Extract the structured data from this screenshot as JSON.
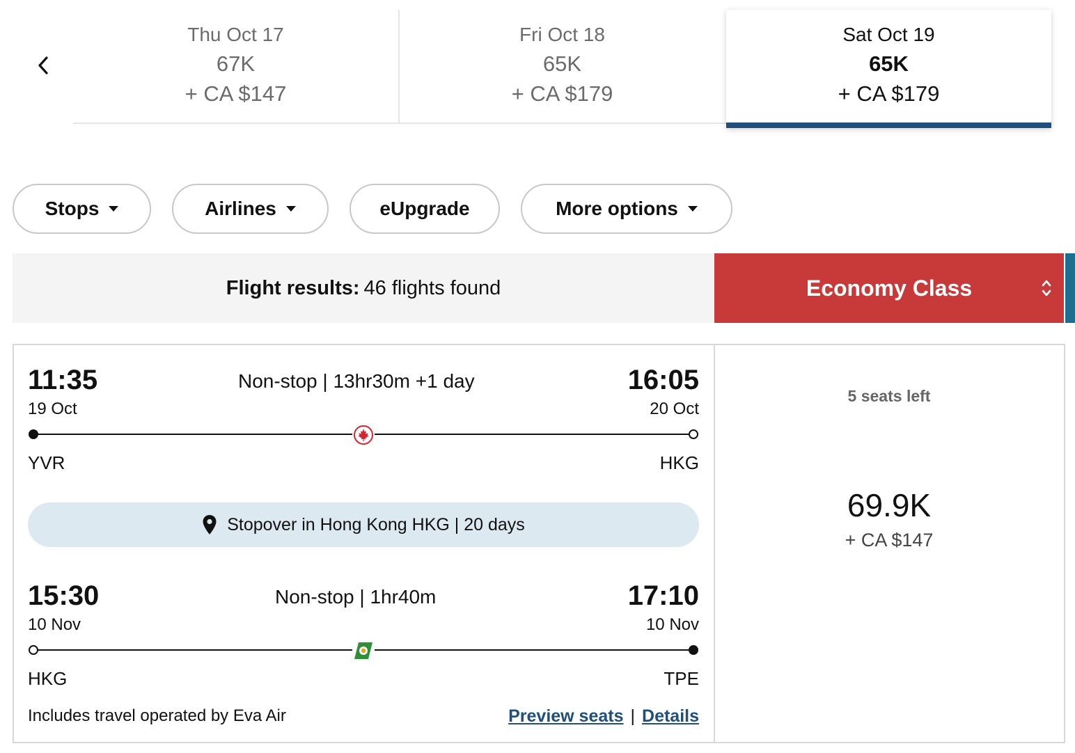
{
  "date_strip": {
    "prev_icon": "chevron-left-icon",
    "dates": [
      {
        "date": "Thu Oct 17",
        "points": "67K",
        "cash": "+ CA $147",
        "selected": false
      },
      {
        "date": "Fri Oct 18",
        "points": "65K",
        "cash": "+ CA $179",
        "selected": false
      },
      {
        "date": "Sat Oct 19",
        "points": "65K",
        "cash": "+ CA $179",
        "selected": true
      }
    ],
    "selected_underline_color": "#1f4f7a"
  },
  "filters": {
    "stops": "Stops",
    "airlines": "Airlines",
    "eupgrade": "eUpgrade",
    "more_options": "More options"
  },
  "results": {
    "label": "Flight results:",
    "count_text": "46 flights found"
  },
  "cabin": {
    "label": "Economy Class",
    "color": "#c83a3a"
  },
  "flight": {
    "segments": [
      {
        "depart_time": "11:35",
        "depart_date": "19 Oct",
        "depart_airport": "YVR",
        "duration": "Non-stop | 13hr30m",
        "day_offset": "+1 day",
        "arrive_time": "16:05",
        "arrive_date": "20 Oct",
        "arrive_airport": "HKG",
        "airline_icon": "air-canada-maple-leaf-icon"
      },
      {
        "depart_time": "15:30",
        "depart_date": "10 Nov",
        "depart_airport": "HKG",
        "duration": "Non-stop | 1hr40m",
        "arrive_time": "17:10",
        "arrive_date": "10 Nov",
        "arrive_airport": "TPE",
        "airline_icon": "eva-air-tail-icon"
      }
    ],
    "stopover": {
      "icon": "map-pin-icon",
      "text": "Stopover in Hong Kong HKG | 20 days"
    },
    "operated_by": "Includes travel operated by Eva Air",
    "links": {
      "preview_seats": "Preview seats",
      "separator": "|",
      "details": "Details"
    },
    "fare": {
      "seats_left": "5 seats left",
      "points": "69.9K",
      "cash": "+ CA $147"
    }
  }
}
